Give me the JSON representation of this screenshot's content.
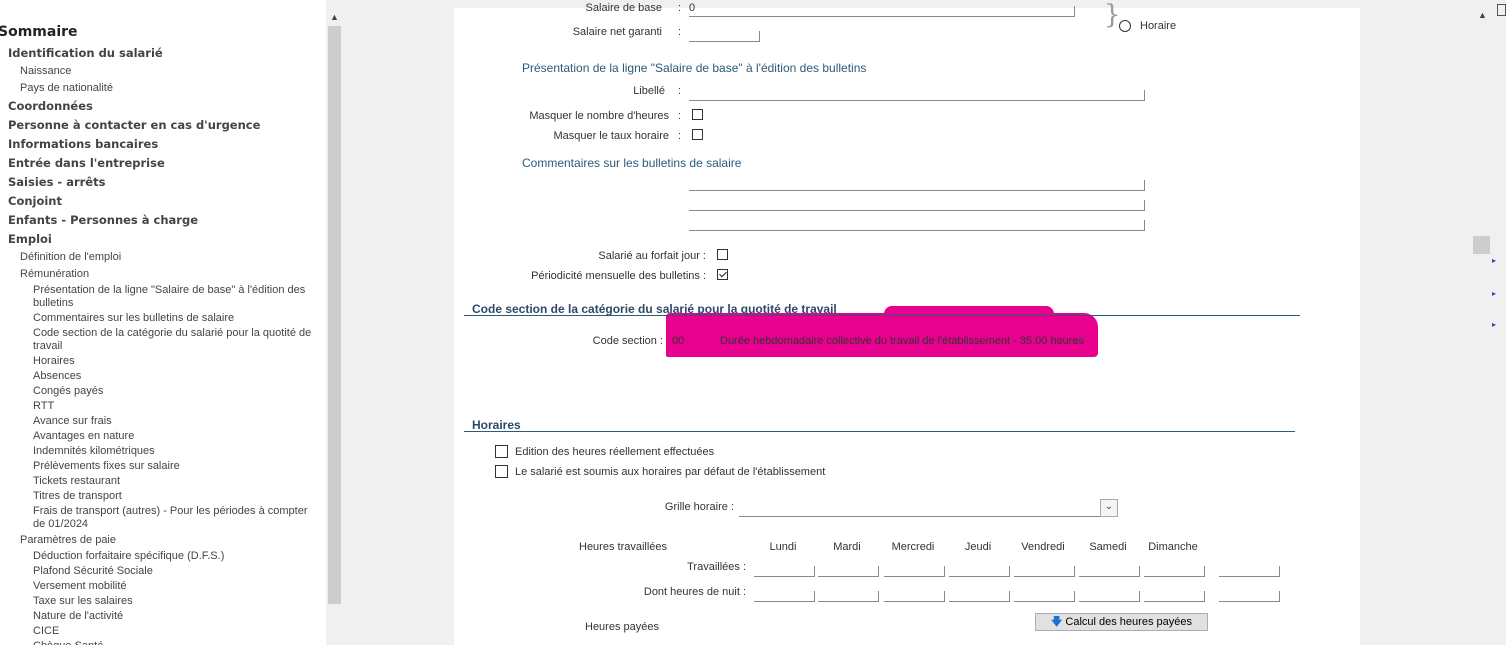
{
  "sidebar": {
    "title": "Sommaire",
    "items": [
      {
        "label": "Identification du salarié",
        "level": 0
      },
      {
        "label": "Naissance",
        "level": 1
      },
      {
        "label": "Pays de nationalité",
        "level": 1
      },
      {
        "label": "Coordonnées",
        "level": 0
      },
      {
        "label": "Personne à contacter en cas d'urgence",
        "level": 0
      },
      {
        "label": "Informations bancaires",
        "level": 0
      },
      {
        "label": "Entrée dans l'entreprise",
        "level": 0
      },
      {
        "label": "Saisies - arrêts",
        "level": 0
      },
      {
        "label": "Conjoint",
        "level": 0
      },
      {
        "label": "Enfants - Personnes à charge",
        "level": 0
      },
      {
        "label": "Emploi",
        "level": 0
      },
      {
        "label": "Définition de l'emploi",
        "level": 1
      },
      {
        "label": "Rémunération",
        "level": 1
      },
      {
        "label": "Présentation de la ligne \"Salaire de base\" à l'édition des bulletins",
        "level": 2
      },
      {
        "label": "Commentaires sur les bulletins de salaire",
        "level": 2
      },
      {
        "label": "Code section de la catégorie du salarié pour la quotité de travail",
        "level": 2
      },
      {
        "label": "Horaires",
        "level": 2
      },
      {
        "label": "Absences",
        "level": 2
      },
      {
        "label": "Congés payés",
        "level": 2
      },
      {
        "label": "RTT",
        "level": 2
      },
      {
        "label": "Avance sur frais",
        "level": 2
      },
      {
        "label": "Avantages en nature",
        "level": 2
      },
      {
        "label": "Indemnités kilométriques",
        "level": 2
      },
      {
        "label": "Prélèvements fixes sur salaire",
        "level": 2
      },
      {
        "label": "Tickets restaurant",
        "level": 2
      },
      {
        "label": "Titres de transport",
        "level": 2
      },
      {
        "label": "Frais de transport (autres) - Pour les périodes à compter de 01/2024",
        "level": 2
      },
      {
        "label": "Paramètres de paie",
        "level": 1
      },
      {
        "label": "Déduction forfaitaire spécifique (D.F.S.)",
        "level": 2
      },
      {
        "label": "Plafond Sécurité Sociale",
        "level": 2
      },
      {
        "label": "Versement mobilité",
        "level": 2
      },
      {
        "label": "Taxe sur les salaires",
        "level": 2
      },
      {
        "label": "Nature de l'activité",
        "level": 2
      },
      {
        "label": "CICE",
        "level": 2
      },
      {
        "label": "Chèque Santé",
        "level": 2
      }
    ]
  },
  "form": {
    "salaire_base_label": "Salaire de base",
    "salaire_base_value": "0",
    "salaire_net_label": "Salaire net garanti",
    "colon": ":",
    "horaire_radio_label": "Horaire",
    "presentation_section": "Présentation de la ligne \"Salaire de base\" à l'édition des bulletins",
    "libelle_label": "Libellé",
    "masquer_heures_label": "Masquer le nombre d'heures",
    "masquer_taux_label": "Masquer le taux horaire",
    "commentaires_section": "Commentaires sur les bulletins de salaire",
    "forfait_jour_label": "Salarié au forfait jour :",
    "periodicite_label": "Périodicité mensuelle des bulletins :",
    "code_section_header": "Code section de la catégorie du salarié pour la quotité de travail",
    "code_section_label": "Code section :",
    "code_section_code": "00",
    "code_section_value": "Durée hebdomadaire collective du travail de l'établissement - 35.00 heures",
    "horaires_header": "Horaires",
    "edition_heures_label": "Edition des heures réellement effectuées",
    "horaires_defaut_label": "Le salarié est soumis aux horaires par défaut de l'établissement",
    "grille_label": "Grille horaire :",
    "heures_travaillees_label": "Heures travaillées",
    "days": [
      "Lundi",
      "Mardi",
      "Mercredi",
      "Jeudi",
      "Vendredi",
      "Samedi",
      "Dimanche"
    ],
    "travaillees_label": "Travaillées :",
    "nuit_label": "Dont heures de nuit :",
    "heures_payees_label": "Heures payées",
    "calcul_button": "Calcul des heures payées",
    "masquer_heures_checked": false,
    "masquer_taux_checked": false,
    "forfait_checked": false,
    "periodicite_checked": true,
    "edition_checked": false,
    "defaut_checked": false
  },
  "colors": {
    "highlight": "#e8008f",
    "section_blue": "#2b5a7a"
  }
}
